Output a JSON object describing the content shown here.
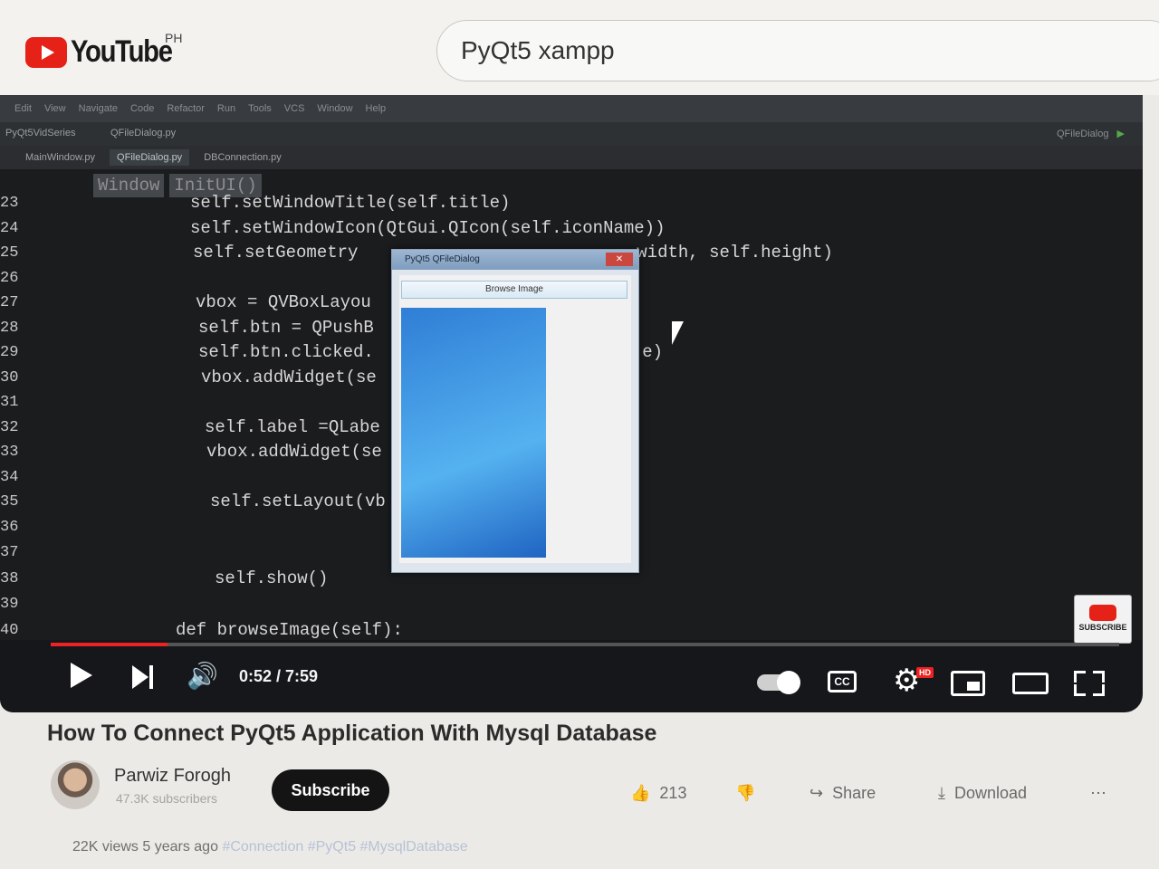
{
  "header": {
    "logo_text": "YouTube",
    "country": "PH",
    "search_value": "PyQt5 xampp"
  },
  "ide": {
    "menu": [
      "Edit",
      "View",
      "Navigate",
      "Code",
      "Refactor",
      "Run",
      "Tools",
      "VCS",
      "Window",
      "Help"
    ],
    "project": "PyQt5VidSeries",
    "file": "QFileDialog.py",
    "run_config": "QFileDialog",
    "tabs": [
      "MainWindow.py",
      "QFileDialog.py",
      "DBConnection.py"
    ],
    "breadcrumb": [
      "Window",
      "InitUI()"
    ],
    "lines": [
      {
        "n": "23",
        "code": "self.setWindowTitle(self.title)"
      },
      {
        "n": "24",
        "code": "self.setWindowIcon(QtGui.QIcon(self.iconName))"
      },
      {
        "n": "25",
        "code": "self.setGeometry                          .width, self.height)"
      },
      {
        "n": "26",
        "code": ""
      },
      {
        "n": "27",
        "code": "vbox = QVBoxLayou"
      },
      {
        "n": "28",
        "code": "self.btn = QPushB"
      },
      {
        "n": "29",
        "code": "self.btn.clicked.                          e)"
      },
      {
        "n": "30",
        "code": "vbox.addWidget(se"
      },
      {
        "n": "31",
        "code": ""
      },
      {
        "n": "32",
        "code": "self.label =QLabe"
      },
      {
        "n": "33",
        "code": "vbox.addWidget(se"
      },
      {
        "n": "34",
        "code": ""
      },
      {
        "n": "35",
        "code": "self.setLayout(vb"
      },
      {
        "n": "36",
        "code": ""
      },
      {
        "n": "37",
        "code": ""
      },
      {
        "n": "38",
        "code": "self.show()"
      },
      {
        "n": "39",
        "code": ""
      },
      {
        "n": "40",
        "code": "def browseImage(self):"
      }
    ],
    "dialog_title": "PyQt5 QFileDialog",
    "dialog_button": "Browse Image"
  },
  "player": {
    "time": "0:52 / 7:59",
    "progress": 0.109,
    "hd_badge": "HD",
    "cc_label": "CC",
    "watermark_label": "SUBSCRIBE"
  },
  "video": {
    "title": "How To Connect PyQt5 Application With Mysql Database",
    "channel": "Parwiz Forogh",
    "subscribers": "47.3K subscribers",
    "subscribe_label": "Subscribe",
    "likes": "213",
    "share_label": "Share",
    "download_label": "Download",
    "meta": "22K views  5 years ago",
    "hashtags": "#Connection #PyQt5 #MysqlDatabase"
  }
}
